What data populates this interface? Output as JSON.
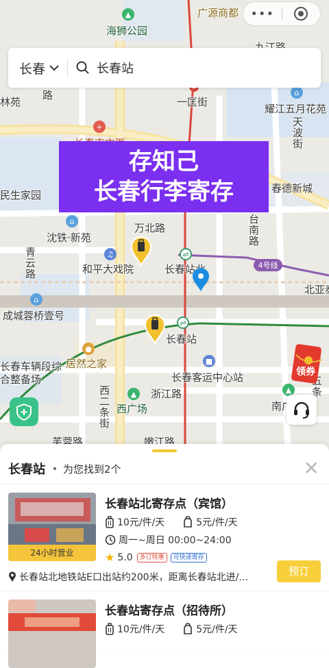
{
  "map": {
    "labels": {
      "haishi_park": "海狮公园",
      "guangyuan_mall": "广源商都",
      "jiujiang_road": "九江路",
      "yikuang_street": "一匡街",
      "yuejiang_garden": "耀江五月花苑",
      "tianbo_street": "天波街",
      "linyuan": "林苑",
      "road_lu": "路",
      "changchun_hospital": "长春市中医",
      "minsheng_home": "民生家园",
      "chunde_city": "春德新城",
      "wanbei_road": "万北路",
      "tainan_road": "台南路",
      "shentie_xinyuan": "沈铁·新苑",
      "heping_theater": "和平大戏院",
      "changchun_north": "长春站北",
      "line4": "4号线",
      "beiya": "北亚泰",
      "qingyun_road": "青云路",
      "chengcheng_rongqiao": "成城蓉桥壹号",
      "changchun_station": "长春站",
      "vehicle_depot": "长春车辆段综合整备场",
      "juran_home": "居然之家",
      "bus_center": "长春客运中心站",
      "zhejiang_road": "浙江路",
      "xier_tiao": "西二条街",
      "xi_square": "西广场",
      "nanguang": "南广",
      "wu_tiao": "五条",
      "furong_road": "芙蓉路",
      "nenjiang_road": "嫩江路",
      "park": "公园"
    }
  },
  "capsule": {
    "more_icon": "more-dots-icon",
    "close_icon": "target-circle-icon"
  },
  "search": {
    "city": "长春",
    "query": "长春站"
  },
  "banner": {
    "line1": "存知己",
    "line2": "长春行李寄存"
  },
  "coupon": {
    "label": "领券"
  },
  "panel": {
    "title": "长春站",
    "summary": "为您找到2个",
    "close": "✕",
    "results": [
      {
        "name": "长春站北寄存点（宾馆）",
        "price_large": "10元/件/天",
        "price_small": "5元/件/天",
        "hours": "周一~周日 00:00~24:00",
        "rating": "5.0",
        "badges": [
          "多订特惠",
          "可快递寄存"
        ],
        "thumb_tag": "24小时营业",
        "address": "长春站北地铁站E口出站约200米，距离长春站北进/…",
        "book_label": "预订"
      },
      {
        "name": "长春站寄存点（招待所）",
        "price_large": "10元/件/天",
        "price_small": "5元/件/天"
      }
    ]
  },
  "colors": {
    "accent": "#f7cf3b",
    "banner": "#7b2ff0",
    "pin_blue": "#1e8de0",
    "line4": "#8b5bb0",
    "rail_green": "#2f8a3c"
  }
}
